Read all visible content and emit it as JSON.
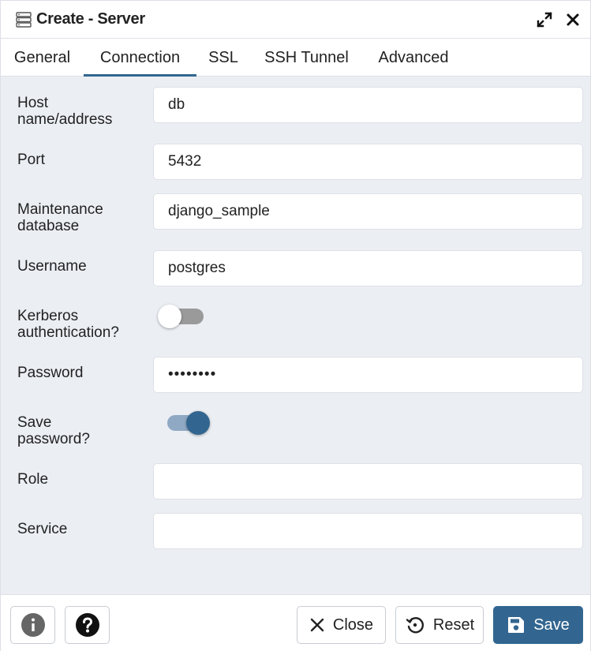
{
  "window": {
    "title": "Create - Server",
    "icons": {
      "title": "server-icon",
      "expand": "expand-icon",
      "close": "close-icon"
    }
  },
  "tabs": [
    {
      "label": "General",
      "active": false
    },
    {
      "label": "Connection",
      "active": true
    },
    {
      "label": "SSL",
      "active": false
    },
    {
      "label": "SSH Tunnel",
      "active": false
    },
    {
      "label": "Advanced",
      "active": false
    }
  ],
  "form": {
    "host": {
      "label_line1": "Host",
      "label_line2": "name/address",
      "value": "db"
    },
    "port": {
      "label": "Port",
      "value": "5432"
    },
    "maintenance_db": {
      "label_line1": "Maintenance",
      "label_line2": "database",
      "value": "django_sample"
    },
    "username": {
      "label": "Username",
      "value": "postgres"
    },
    "kerberos": {
      "label_line1": "Kerberos",
      "label_line2": "authentication?",
      "enabled": false
    },
    "password": {
      "label": "Password",
      "value": "••••••••"
    },
    "save_password": {
      "label_line1": "Save",
      "label_line2": "password?",
      "enabled": true
    },
    "role": {
      "label": "Role",
      "value": ""
    },
    "service": {
      "label": "Service",
      "value": ""
    }
  },
  "footer": {
    "info_icon": "info-icon",
    "help_icon": "help-icon",
    "close_label": "Close",
    "reset_label": "Reset",
    "save_label": "Save"
  },
  "colors": {
    "accent": "#326690",
    "background": "#ebeef3",
    "border": "#dde0e6",
    "toggle_off": "#9a9a9a"
  }
}
